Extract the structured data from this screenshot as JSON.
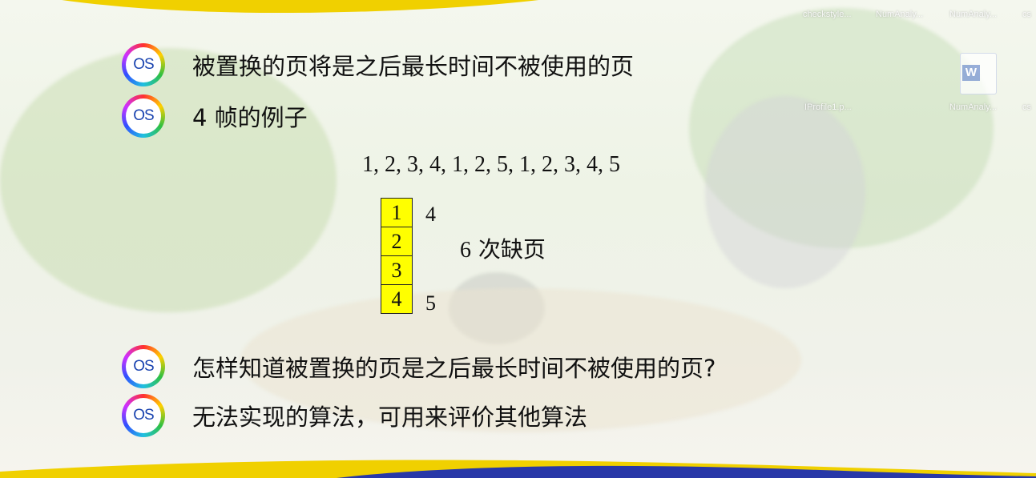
{
  "slide": {
    "bullets": [
      {
        "icon_label": "OS",
        "text": "被置换的页将是之后最长时间不被使用的页"
      },
      {
        "icon_label": "OS",
        "text": "4 帧的例子"
      },
      {
        "icon_label": "OS",
        "text": "怎样知道被置换的页是之后最长时间不被使用的页?"
      },
      {
        "icon_label": "OS",
        "text": "无法实现的算法，可用来评价其他算法"
      }
    ],
    "reference_string": "1, 2, 3, 4, 1, 2, 5, 1, 2, 3, 4, 5",
    "frames": [
      "1",
      "2",
      "3",
      "4"
    ],
    "replacement_top": "4",
    "replacement_bottom": "5",
    "fault_count": "6",
    "fault_label": "次缺页",
    "frame_color": "#ffff00",
    "accent_yellow": "#f0d000",
    "accent_blue": "#1a44b0"
  },
  "desktop": {
    "top_labels": [
      "checkstyle...",
      "NumAnaly...",
      "NumAnaly...",
      "cs"
    ],
    "mid_labels": [
      "IProfile1.p...",
      "NumAnaly...",
      "cs"
    ],
    "word_icon": "word-document-icon"
  }
}
